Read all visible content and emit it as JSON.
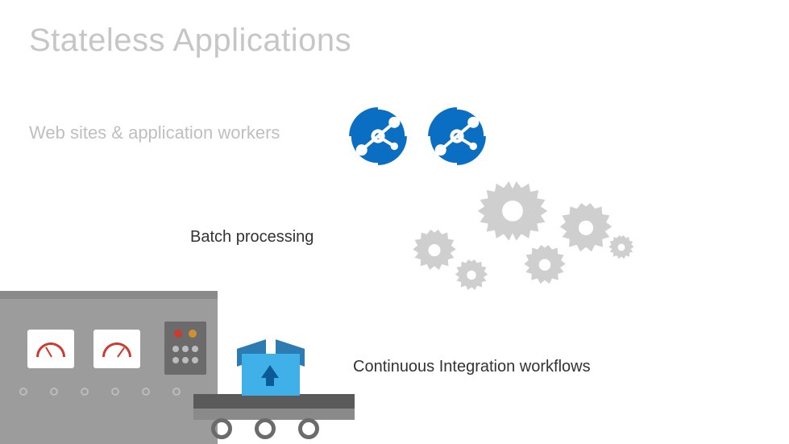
{
  "title": "Stateless Applications",
  "labels": {
    "websites": "Web sites & application workers",
    "batch": "Batch processing",
    "ci": "Continuous Integration workflows"
  },
  "icons": {
    "app_service": "azure-app-service-icon",
    "gear": "gear-icon",
    "factory": "factory-machine-icon",
    "box": "open-box-upload-icon"
  },
  "colors": {
    "accent_blue": "#0a6fc2",
    "muted_gray": "#c6c6c6"
  }
}
